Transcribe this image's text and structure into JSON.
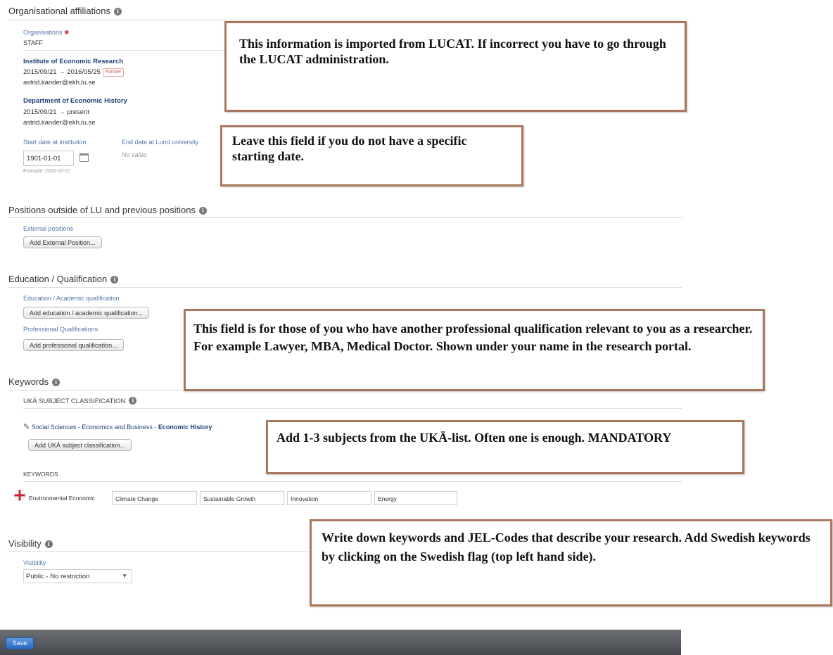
{
  "sections": {
    "org": {
      "title": "Organisational affiliations"
    },
    "positions": {
      "title": "Positions outside of LU and previous positions"
    },
    "education": {
      "title": "Education / Qualification"
    },
    "keywords": {
      "title": "Keywords"
    },
    "visibility": {
      "title": "Visibility"
    }
  },
  "org": {
    "organisations_label": "Organisations",
    "staff_label": "STAFF",
    "affiliations": [
      {
        "name": "Institute of Economic Research",
        "dates": "2015/09/21 → 2016/05/25",
        "badge": "Former",
        "email": "astrid.kander@ekh.lu.se"
      },
      {
        "name": "Department of Economic History",
        "dates": "2015/09/21 → present",
        "email": "astrid.kander@ekh.lu.se"
      }
    ],
    "start_date_label": "Start date at institution",
    "start_date_value": "1901-01-01",
    "start_date_example": "Example: 2002-10-21",
    "end_date_label": "End date at Lund university",
    "end_date_value": "No value"
  },
  "positions": {
    "external_label": "External positions",
    "add_button": "Add External Position..."
  },
  "education": {
    "academic_label": "Education / Academic qualification",
    "academic_button": "Add education / academic qualification...",
    "professional_label": "Professional Qualifications",
    "professional_button": "Add professional qualification..."
  },
  "keywords": {
    "uka_heading": "UKÄ SUBJECT CLASSIFICATION",
    "subject_path": "Social Sciences - Economics and Business - ",
    "subject_leaf": "Economic History",
    "add_uka_button": "Add UKÄ subject classification...",
    "keywords_heading": "KEYWORDS",
    "values": [
      "Environmental Economic",
      "Climate Change",
      "Sustainable Growth",
      "Innovation",
      "Energy"
    ]
  },
  "visibility": {
    "label": "Visibility",
    "value": "Public - No restriction"
  },
  "footer": {
    "save_label": "Save"
  },
  "callouts": {
    "lucat": "This information is imported from LUCAT. If incorrect you have to go through the LUCAT administration.",
    "start_date": "Leave this field if you do not have a specific starting date.",
    "professional": "This field is for those of you who have another professional qualification relevant to you as a researcher. For example Lawyer, MBA, Medical Doctor. Shown under your name in the research portal.",
    "uka": "Add 1-3 subjects from the UKÄ-list. Often one is enough. MANDATORY",
    "keywords": "Write down keywords and JEL-Codes that describe your research. Add Swedish keywords by clicking on the Swedish flag (top left hand side)."
  },
  "colors": {
    "callout_border": "#a9785c",
    "link": "#1d3f78",
    "footer": "#505357",
    "save": "#2f72c9"
  }
}
